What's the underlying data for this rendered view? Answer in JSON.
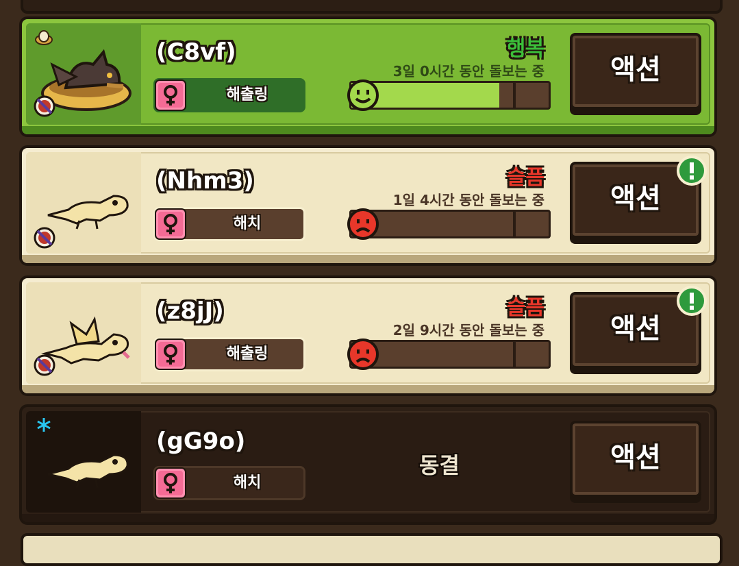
{
  "colors": {
    "happy": "#3bbf3a",
    "sad": "#e8372a",
    "frozen_icon": "#29c6f0"
  },
  "pets": [
    {
      "name": "(C8vf)",
      "stage": "해출링",
      "gender_icon": "female-icon",
      "mood": "행복",
      "mood_face": "happy-face-icon",
      "care_text": "3일 0시간 동안 돌보는 중",
      "happiness_fraction": 0.75,
      "action_label": "액션",
      "status_icon": "egg-badge-icon",
      "theme": "green"
    },
    {
      "name": "(Nhm3)",
      "stage": "해치",
      "gender_icon": "female-icon",
      "mood": "슬픔",
      "mood_face": "sad-face-icon",
      "care_text": "1일 4시간 동안 돌보는 중",
      "happiness_fraction": 0.0,
      "action_label": "액션",
      "alert_icon": "exclamation-icon",
      "theme": "cream"
    },
    {
      "name": "(z8jJ)",
      "stage": "해출링",
      "gender_icon": "female-icon",
      "mood": "슬픔",
      "mood_face": "sad-face-icon",
      "care_text": "2일 9시간 동안 돌보는 중",
      "happiness_fraction": 0.0,
      "action_label": "액션",
      "alert_icon": "exclamation-icon",
      "theme": "cream"
    },
    {
      "name": "(gG9o)",
      "stage": "해치",
      "gender_icon": "female-icon",
      "status": "동결",
      "action_label": "액션",
      "status_icon": "snowflake-icon",
      "theme": "dark"
    }
  ]
}
